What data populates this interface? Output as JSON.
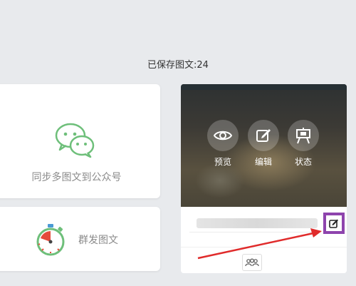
{
  "header": {
    "saved_count": "已保存图文:24"
  },
  "sync_card": {
    "label": "同步多图文到公众号",
    "icon": "wechat-icon"
  },
  "mass_card": {
    "label": "群发图文",
    "icon": "timer-icon"
  },
  "article_card": {
    "actions": [
      {
        "label": "预览",
        "icon": "eye-icon"
      },
      {
        "label": "编辑",
        "icon": "edit-icon"
      },
      {
        "label": "状态",
        "icon": "easel-icon"
      }
    ],
    "edit_title_icon": "edit-icon",
    "group_icon": "people-icon"
  },
  "colors": {
    "highlight": "#8e44ad",
    "arrow": "#e02b2b",
    "wechat_green": "#6ebf7a"
  }
}
